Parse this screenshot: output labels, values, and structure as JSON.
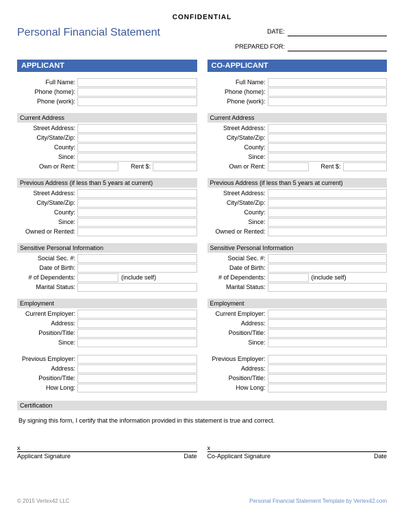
{
  "confidential": "CONFIDENTIAL",
  "title": "Personal Financial Statement",
  "date_label": "DATE:",
  "prepared_label": "PREPARED FOR:",
  "applicant_header": "APPLICANT",
  "coapplicant_header": "CO-APPLICANT",
  "fields": {
    "full_name": "Full Name:",
    "phone_home": "Phone (home):",
    "phone_work": "Phone (work):",
    "current_address": "Current Address",
    "street": "Street Address:",
    "csz": "City/State/Zip:",
    "county": "County:",
    "since": "Since:",
    "own_or_rent": "Own or Rent:",
    "rent_amt": "Rent $:",
    "prev_address": "Previous Address",
    "prev_sub": "(if less than 5 years at current)",
    "owned_rented": "Owned or Rented:",
    "sensitive": "Sensitive Personal Information",
    "ssn": "Social Sec. #:",
    "dob": "Date of Birth:",
    "dependents": "# of Dependents:",
    "include_self": "(include self)",
    "marital": "Marital Status:",
    "employment": "Employment",
    "cur_employer": "Current Employer:",
    "address": "Address:",
    "position": "Position/Title:",
    "emp_since": "Since:",
    "prev_employer": "Previous Employer:",
    "how_long": "How Long:"
  },
  "cert": {
    "header": "Certification",
    "text": "By signing this form, I certify that the information provided in this statement is true and correct.",
    "x": "x",
    "app_sig": "Applicant Signature",
    "coapp_sig": "Co-Applicant Signature",
    "date": "Date"
  },
  "footer": {
    "left": "© 2015 Vertex42 LLC",
    "right": "Personal Financial Statement Template by Vertex42.com"
  }
}
